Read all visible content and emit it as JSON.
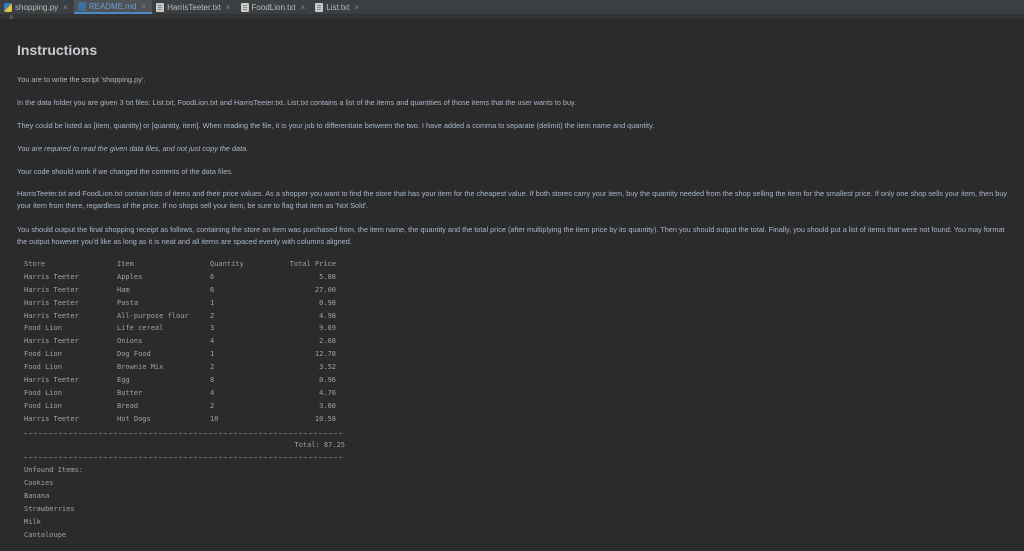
{
  "tabs": [
    {
      "label": "shopping.py",
      "icon": "python-file-icon",
      "active": false
    },
    {
      "label": "README.md",
      "icon": "markdown-file-icon",
      "active": true
    },
    {
      "label": "HarrisTeeter.txt",
      "icon": "text-file-icon",
      "active": false
    },
    {
      "label": "FoodLion.txt",
      "icon": "text-file-icon",
      "active": false
    },
    {
      "label": "List.txt",
      "icon": "text-file-icon",
      "active": false
    }
  ],
  "doc": {
    "title": "Instructions",
    "p1": "You are to write the script 'shopping.py'.",
    "p2": "In the data folder you are given 3 txt files: List.txt, FoodLion.txt and HarrisTeeter.txt. List.txt contains a list of the items and quantities of those items that the user wants to buy.",
    "p3": "They could be listed as [item, quantity] or [quantity, item]. When reading the file, it is your job to differentiate between the two. I have added a comma to separate (delimit) the item name and quantity.",
    "p4": "You are required to read the given data files, and not just copy the data.",
    "p5": "Your code should work if we changed the contents of the data files.",
    "p6": "HarrisTeeter.txt and FoodLion.txt contain lists of items and their price values. As a shopper you want to find the store that has your item for the cheapest value. If both stores carry your item, buy the quantity needed from the shop selling the item for the smallest price. If only one shop sells your item, then buy your item from there, regardless of the price. If no shops sell your item, be sure to flag that item as 'Not Sold'.",
    "p7": "You should output the final shopping receipt as follows, containing the store an item was purchased from, the item name, the quantity and the total price (after multiplying the item price by its quantity). Then you should output the total. Finally, you should put a list of items that were not found. You may format the output however you'd like as long as it is neat and all items are spaced evenly with columns aligned."
  },
  "receipt": {
    "headers": [
      "Store",
      "Item",
      "Quantity",
      "Total Price"
    ],
    "rows": [
      [
        "Harris Teeter",
        "Apples",
        "6",
        "5.88"
      ],
      [
        "Harris Teeter",
        "Ham",
        "6",
        "27.00"
      ],
      [
        "Harris Teeter",
        "Pasta",
        "1",
        "0.98"
      ],
      [
        "Harris Teeter",
        "All-purpose flour",
        "2",
        "4.98"
      ],
      [
        "Food Lion",
        "Life cereal",
        "3",
        "9.69"
      ],
      [
        "Harris Teeter",
        "Onions",
        "4",
        "2.68"
      ],
      [
        "Food Lion",
        "Dog Food",
        "1",
        "12.78"
      ],
      [
        "Food Lion",
        "Brownie Mix",
        "2",
        "3.52"
      ],
      [
        "Harris Teeter",
        "Egg",
        "8",
        "0.96"
      ],
      [
        "Food Lion",
        "Butter",
        "4",
        "4.76"
      ],
      [
        "Food Lion",
        "Bread",
        "2",
        "3.60"
      ],
      [
        "Harris Teeter",
        "Hot Dogs",
        "10",
        "10.58"
      ]
    ],
    "total": "Total: 87.25",
    "unfound_label": "Unfound Items:",
    "unfound": [
      "Cookies",
      "Banana",
      "Strawberries",
      "Milk",
      "Cantaloupe"
    ]
  }
}
